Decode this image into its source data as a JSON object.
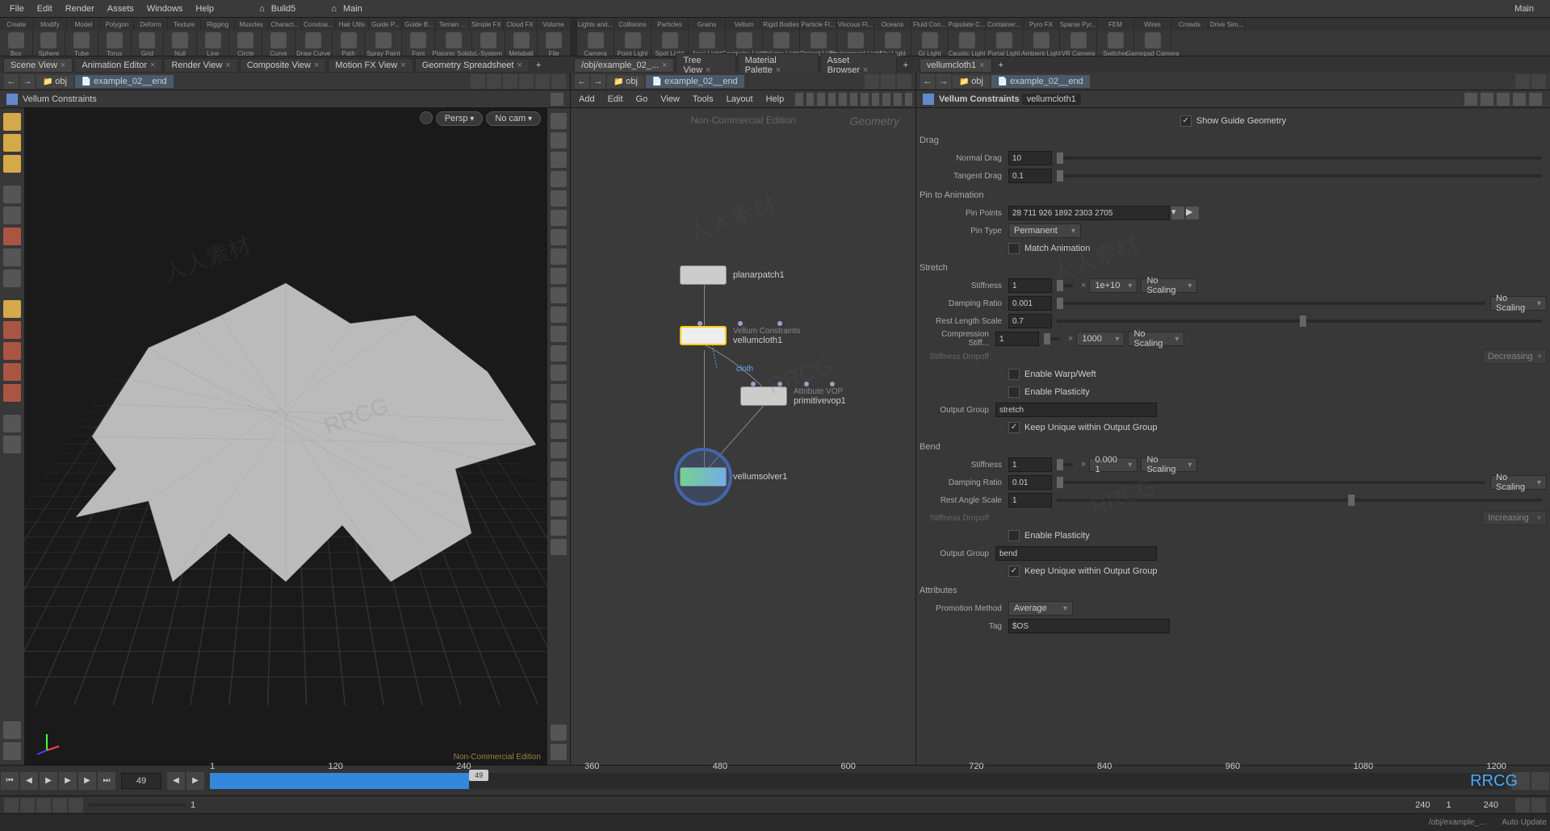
{
  "menu": {
    "items": [
      "File",
      "Edit",
      "Render",
      "Assets",
      "Windows",
      "Help"
    ],
    "build": "Build5",
    "main": "Main",
    "main2": "Main"
  },
  "shelf1": [
    {
      "l": "Create"
    },
    {
      "l": "Modify"
    },
    {
      "l": "Model"
    },
    {
      "l": "Polygon"
    },
    {
      "l": "Deform"
    },
    {
      "l": "Texture"
    },
    {
      "l": "Rigging"
    },
    {
      "l": "Muscles"
    },
    {
      "l": "Charact..."
    },
    {
      "l": "Constrai..."
    },
    {
      "l": "Hair Utils"
    },
    {
      "l": "Guide P..."
    },
    {
      "l": "Guide B..."
    },
    {
      "l": "Terrain ..."
    },
    {
      "l": "Simple FX"
    },
    {
      "l": "Cloud FX"
    },
    {
      "l": "Volume"
    }
  ],
  "shelf1b": [
    {
      "l": "Box"
    },
    {
      "l": "Sphere"
    },
    {
      "l": "Tube"
    },
    {
      "l": "Torus"
    },
    {
      "l": "Grid"
    },
    {
      "l": "Null"
    },
    {
      "l": "Line"
    },
    {
      "l": "Circle"
    },
    {
      "l": "Curve"
    },
    {
      "l": "Draw Curve"
    },
    {
      "l": "Path"
    },
    {
      "l": "Spray Paint"
    },
    {
      "l": "Font"
    },
    {
      "l": "Platonic Solids"
    },
    {
      "l": "L-System"
    },
    {
      "l": "Metaball"
    },
    {
      "l": "File"
    }
  ],
  "shelf2": [
    {
      "l": "Lights and..."
    },
    {
      "l": "Collisions"
    },
    {
      "l": "Particles"
    },
    {
      "l": "Grains"
    },
    {
      "l": "Vellum"
    },
    {
      "l": "Rigid Bodies"
    },
    {
      "l": "Particle Fl..."
    },
    {
      "l": "Viscous Fl..."
    },
    {
      "l": "Oceans"
    },
    {
      "l": "Fluid Con..."
    },
    {
      "l": "Populate C..."
    },
    {
      "l": "Container..."
    },
    {
      "l": "Pyro FX"
    },
    {
      "l": "Sparse Pyr..."
    },
    {
      "l": "FEM"
    },
    {
      "l": "Wires"
    },
    {
      "l": "Crowds"
    },
    {
      "l": "Drive Sim..."
    }
  ],
  "shelf2b": [
    {
      "l": "Camera"
    },
    {
      "l": "Point Light"
    },
    {
      "l": "Spot Light"
    },
    {
      "l": "Area Light"
    },
    {
      "l": "Geometry Light"
    },
    {
      "l": "Volume Light"
    },
    {
      "l": "Distant Light"
    },
    {
      "l": "Environment Light"
    },
    {
      "l": "Sky Light"
    },
    {
      "l": "GI Light"
    },
    {
      "l": "Caustic Light"
    },
    {
      "l": "Portal Light"
    },
    {
      "l": "Ambient Light"
    },
    {
      "l": "VR Camera"
    },
    {
      "l": "Switcher"
    },
    {
      "l": "Gamepad Camera"
    }
  ],
  "viewport_tabs": [
    "Scene View",
    "Animation Editor",
    "Render View",
    "Composite View",
    "Motion FX View",
    "Geometry Spreadsheet"
  ],
  "net_tabs": [
    "/obj/example_02_...",
    "Tree View",
    "Material Palette",
    "Asset Browser"
  ],
  "param_tabs": [
    "vellumcloth1"
  ],
  "path": {
    "obj": "obj",
    "scene": "example_02__end"
  },
  "vp_title": "Vellum Constraints",
  "vp_persp": "Persp",
  "vp_cam": "No cam",
  "vp_footer": "Non-Commercial Edition",
  "net_menu": [
    "Add",
    "Edit",
    "Go",
    "View",
    "Tools",
    "Layout",
    "Help"
  ],
  "net_header": "Geometry",
  "net_sub": "Non-Commercial Edition",
  "nodes": {
    "n1": {
      "name": "planarpatch1",
      "type": ""
    },
    "n2": {
      "name": "vellumcloth1",
      "type": "Vellum Constraints",
      "sub": "cloth"
    },
    "n3": {
      "name": "primitivevop1",
      "type": "Attribute VOP"
    },
    "n4": {
      "name": "vellumsolver1",
      "type": ""
    }
  },
  "params": {
    "title": "Vellum Constraints",
    "node": "vellumcloth1",
    "show_guide": "Show Guide Geometry",
    "drag": {
      "h": "Drag",
      "normal": "Normal Drag",
      "normal_v": "10",
      "tangent": "Tangent Drag",
      "tangent_v": "0.1"
    },
    "pin": {
      "h": "Pin to Animation",
      "points": "Pin Points",
      "points_v": "28 711 926 1892 2303 2705",
      "type": "Pin Type",
      "type_v": "Permanent",
      "match": "Match Animation"
    },
    "stretch": {
      "h": "Stretch",
      "stiff": "Stiffness",
      "stiff_v": "1",
      "stiff_e": "1e+10",
      "scale": "No Scaling",
      "damp": "Damping Ratio",
      "damp_v": "0.001",
      "rest": "Rest Length Scale",
      "rest_v": "0.7",
      "comp": "Compression Stiff...",
      "comp_v": "1",
      "comp_e": "1000",
      "dropoff": "Stiffness Dropoff",
      "dropoff_v": "Decreasing",
      "warp": "Enable Warp/Weft",
      "plast": "Enable Plasticity",
      "og": "Output Group",
      "og_v": "stretch",
      "keep": "Keep Unique within Output Group"
    },
    "bend": {
      "h": "Bend",
      "stiff": "Stiffness",
      "stiff_v": "1",
      "stiff_e": "0.000 1",
      "scale": "No Scaling",
      "damp": "Damping Ratio",
      "damp_v": "0.01",
      "rest": "Rest Angle Scale",
      "rest_v": "1",
      "dropoff": "Stiffness Dropoff",
      "dropoff_v": "Increasing",
      "plast": "Enable Plasticity",
      "og": "Output Group",
      "og_v": "bend",
      "keep": "Keep Unique within Output Group"
    },
    "attr": {
      "h": "Attributes",
      "prom": "Promotion Method",
      "prom_v": "Average",
      "tag": "Tag",
      "tag_v": "$OS"
    }
  },
  "timeline": {
    "frame": "49",
    "start": "1",
    "end": "240",
    "end2": "240",
    "ticks": [
      "1",
      "120",
      "240",
      "360",
      "480",
      "600",
      "720",
      "840",
      "960",
      "1080",
      "1200"
    ]
  },
  "bottom": {
    "range_a": "1",
    "range_b": "240",
    "range_c": "1",
    "range_d": "240"
  },
  "status": {
    "path": "/obj/example_...",
    "auto": "Auto Update"
  }
}
